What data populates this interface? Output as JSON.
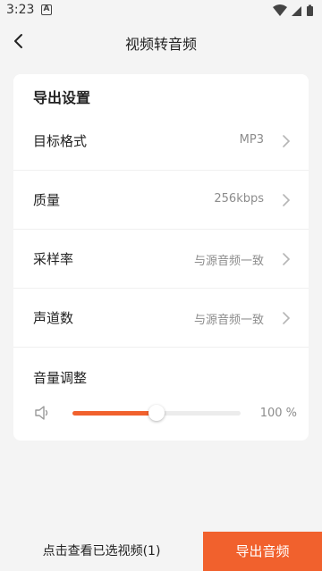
{
  "status_bar": {
    "time": "3:23",
    "notification_glyph": "A"
  },
  "app_bar": {
    "title": "视频转音频",
    "back_icon": "chevron-left-icon"
  },
  "settings": {
    "title": "导出设置",
    "rows": [
      {
        "label": "目标格式",
        "value": "MP3"
      },
      {
        "label": "质量",
        "value": "256kbps"
      },
      {
        "label": "采样率",
        "value": "与源音频一致"
      },
      {
        "label": "声道数",
        "value": "与源音频一致"
      }
    ],
    "volume": {
      "label": "音量调整",
      "level_percent": 50,
      "value_text": "100 %"
    }
  },
  "bottom_bar": {
    "view_selected_label": "点击查看已选视频(1)",
    "export_label": "导出音频"
  },
  "colors": {
    "accent": "#f1612d",
    "background": "#f4f4f4",
    "card": "#ffffff",
    "secondary_text": "#8c8c8c"
  }
}
